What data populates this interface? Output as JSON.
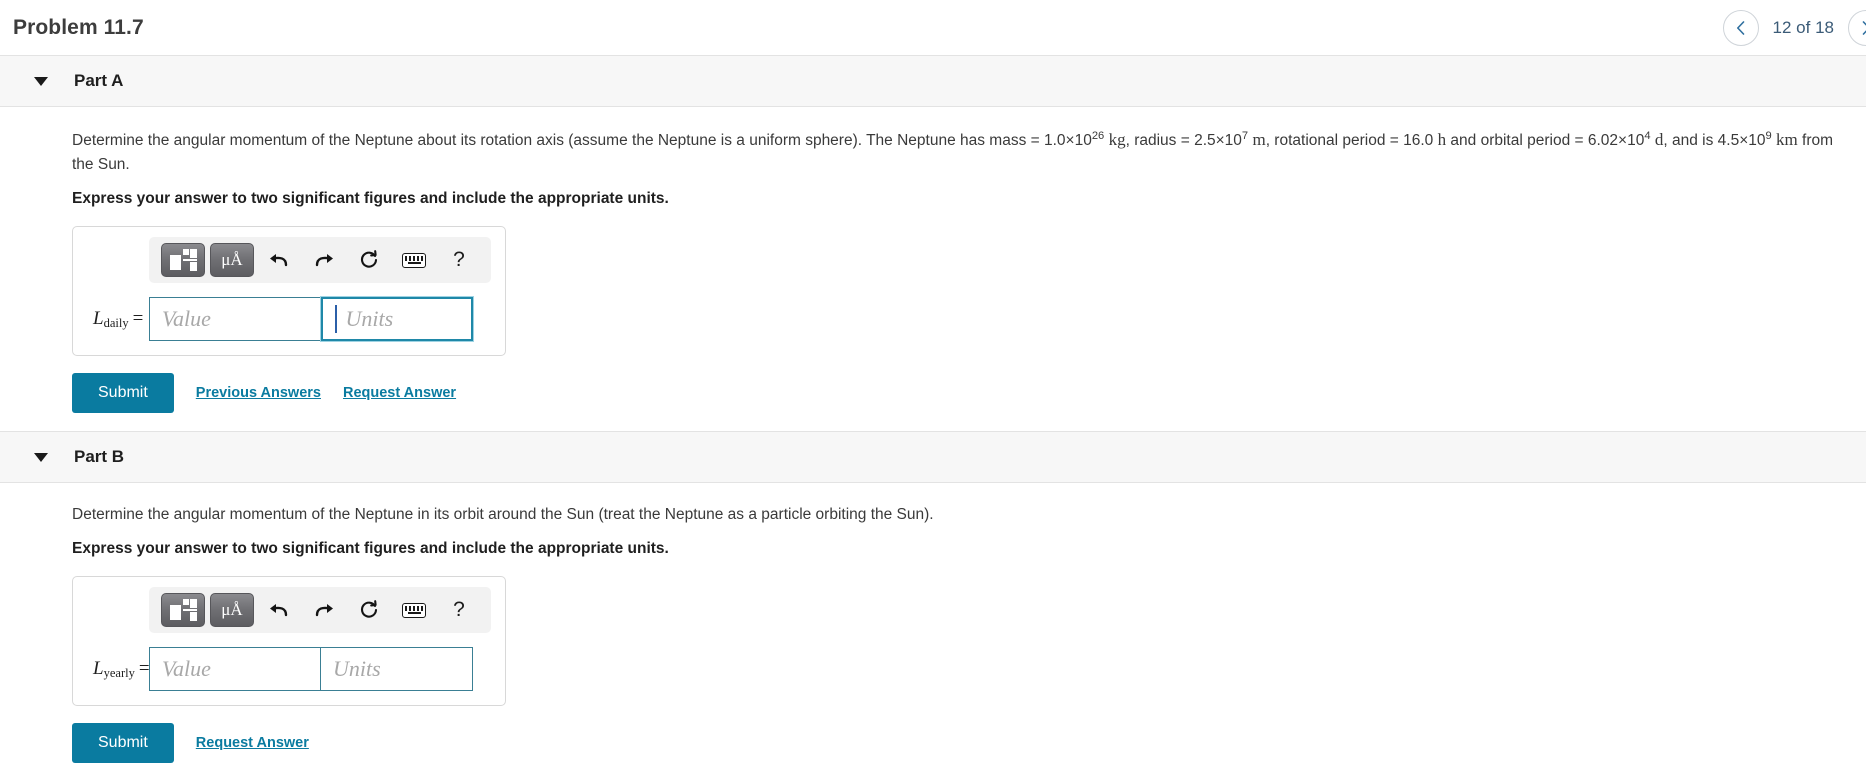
{
  "header": {
    "title": "Problem 11.7",
    "nav": {
      "prev_icon": "chevron-left-icon",
      "next_icon": "chevron-right-icon",
      "counter": "12 of 18"
    }
  },
  "toolbar_icons": {
    "template_label": "template-button",
    "units_label": "μÅ",
    "undo": "undo-icon",
    "redo": "redo-icon",
    "reset": "reset-icon",
    "keyboard": "keyboard-icon",
    "help": "?"
  },
  "colors": {
    "accent": "#0a7ba0",
    "field_border": "#3a7f94",
    "focus_border": "#1f88a8",
    "part_band": "#f7f7f7"
  },
  "parts": [
    {
      "label": "Part A",
      "question_prefix": "Determine the angular momentum of the Neptune about its rotation axis (assume the Neptune is a uniform sphere). The Neptune has mass = ",
      "mass_value": "1.0×10",
      "mass_exp": "26",
      "mass_unit": "kg",
      "mid1": ", radius = ",
      "radius_value": "2.5×10",
      "radius_exp": "7",
      "radius_unit": "m",
      "mid2": ", rotational period = ",
      "rot_value": "16.0",
      "rot_unit": "h",
      "mid3": " and orbital period = ",
      "orb_value": "6.02×10",
      "orb_exp": "4",
      "orb_unit": "d",
      "mid4": ", and is ",
      "dist_value": "4.5×10",
      "dist_exp": "9",
      "dist_unit": "km",
      "tail": " from the Sun.",
      "express": "Express your answer to two significant figures and include the appropriate units.",
      "var_name": "L",
      "var_sub": "daily",
      "equals": "=",
      "value_placeholder": "Value",
      "units_placeholder": "Units",
      "value_text": "",
      "units_text": "",
      "submit_label": "Submit",
      "links": [
        "Previous Answers",
        "Request Answer"
      ]
    },
    {
      "label": "Part B",
      "question": "Determine the angular momentum of the Neptune in its orbit around the Sun (treat the Neptune as a particle orbiting the Sun).",
      "express": "Express your answer to two significant figures and include the appropriate units.",
      "var_name": "L",
      "var_sub": "yearly",
      "equals": "=",
      "value_placeholder": "Value",
      "units_placeholder": "Units",
      "value_text": "",
      "units_text": "",
      "submit_label": "Submit",
      "links": [
        "Request Answer"
      ]
    }
  ]
}
